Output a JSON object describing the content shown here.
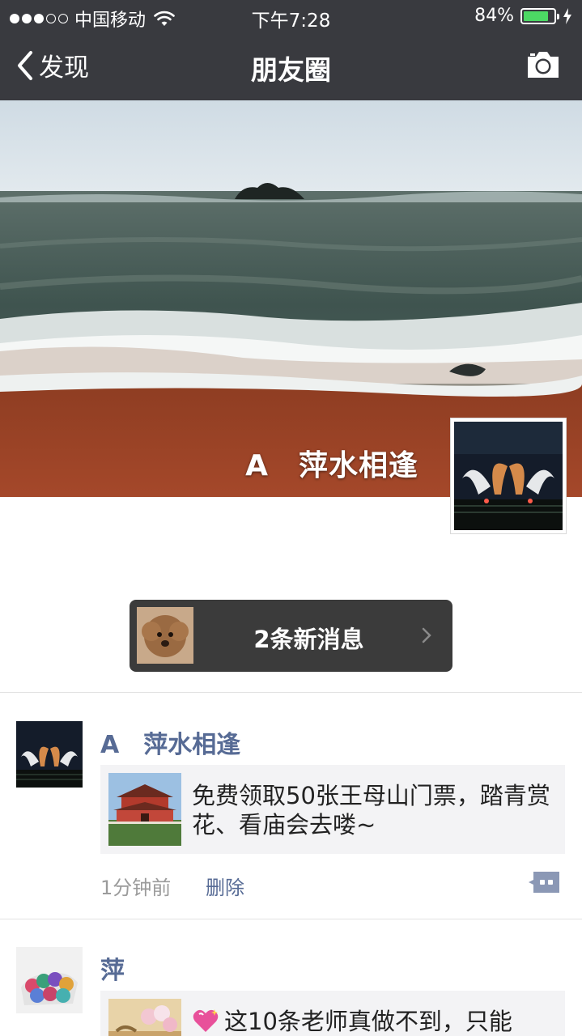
{
  "status_bar": {
    "carrier": "中国移动",
    "time": "下午7:28",
    "battery": "84%",
    "battery_level": 0.84,
    "signal_bars_filled": 3,
    "signal_bars_total": 5
  },
  "nav": {
    "back_label": "发现",
    "title": "朋友圈"
  },
  "profile": {
    "name": "A　萍水相逢"
  },
  "new_messages": {
    "label": "2条新消息"
  },
  "feed": [
    {
      "author": "A　萍水相逢",
      "link_text": "免费领取50张王母山门票，踏青赏花、看庙会去喽~",
      "time": "1分钟前",
      "delete_label": "删除"
    },
    {
      "author": "萍",
      "link_text": "这10条老师真做不到，只能"
    }
  ],
  "colors": {
    "nav_bg": "#393a3f",
    "link_name": "#576b95",
    "card_bg": "#f3f3f5",
    "battery_fill": "#4cd964"
  }
}
